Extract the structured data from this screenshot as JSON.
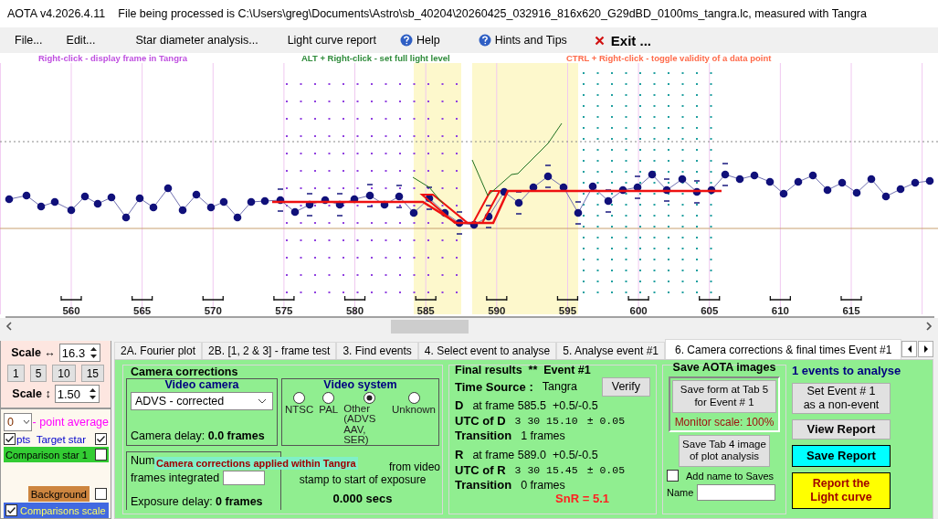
{
  "window": {
    "app_version": "AOTA v4.2026.4.11",
    "title": "File being processed is C:\\Users\\greg\\Documents\\Astro\\sb_40204\\20260425_032916_816x620_G29dBD_0100ms_tangra.lc, measured with Tangra"
  },
  "menu": [
    {
      "label": "File...",
      "kind": "plain"
    },
    {
      "label": "Edit...",
      "kind": "plain"
    },
    {
      "label": "Star diameter analysis...",
      "kind": "plain"
    },
    {
      "label": "Light curve report",
      "kind": "plain"
    },
    {
      "label": "Help",
      "kind": "help"
    },
    {
      "label": "Hints and Tips",
      "kind": "help"
    },
    {
      "label": "Exit ...",
      "kind": "exit"
    }
  ],
  "hints": [
    {
      "text": "Right-click - display frame in Tangra",
      "color": "#bf4fe0"
    },
    {
      "text": "ALT + Right-click - set full light level",
      "color": "#2e8b3a"
    },
    {
      "text": "CTRL + Right-click - toggle validity of a data point",
      "color": "#ff6a4a"
    }
  ],
  "chart": {
    "x_labels": [
      "560",
      "565",
      "570",
      "575",
      "580",
      "585",
      "590",
      "595",
      "600",
      "605",
      "610",
      "615"
    ]
  },
  "scale": {
    "horizontal_label": "Scale ↔",
    "horizontal_value": "16.3",
    "buttons": [
      "1",
      "5",
      "10",
      "15"
    ],
    "vertical_label": "Scale ↕",
    "vertical_value": "1.50"
  },
  "plot_options": {
    "average_value": "0",
    "average_label": "- point average",
    "items": [
      {
        "kind": "points",
        "label": "pts",
        "checked": true
      },
      {
        "kind": "target",
        "label": "Target star",
        "checked": true
      },
      {
        "kind": "band",
        "label": "Comparison star 1",
        "checked": false,
        "color": "#33cc33"
      },
      {
        "kind": "background",
        "label": "Background",
        "checked": false,
        "color": "#cd853f"
      },
      {
        "kind": "band",
        "label": "Comparisons scale",
        "checked": true,
        "color": "#4169e1"
      }
    ]
  },
  "tabs": [
    {
      "label": "2A. Fourier plot",
      "selected": false
    },
    {
      "label": "2B. [1, 2 & 3] - frame test",
      "selected": false
    },
    {
      "label": "3. Find events",
      "selected": false
    },
    {
      "label": "4. Select event to analyse",
      "selected": false
    },
    {
      "label": "5. Analyse event #1",
      "selected": false
    },
    {
      "label": "6. Camera corrections & final times Event #1",
      "selected": true
    }
  ],
  "camera_corrections": {
    "title": "Camera corrections",
    "video_camera": {
      "title": "Video camera",
      "value": "ADVS - corrected",
      "delay": "Camera delay: **0.0 frames**"
    },
    "video_system": {
      "title": "Video system",
      "options": [
        {
          "label": "NTSC",
          "selected": false
        },
        {
          "label": "PAL",
          "selected": false
        },
        {
          "label": "Other (ADVS AAV, SER)",
          "selected": true
        },
        {
          "label": "Unknown",
          "selected": false
        }
      ]
    },
    "frames_label_start": "Num",
    "frames_label_end": "frames integrated",
    "exposure_delay": "Exposure delay: **0 frames**",
    "note_lines": [
      "from video",
      "stamp to start of exposure"
    ],
    "offset": "0.000 secs",
    "overlay": "Camera corrections applied within Tangra"
  },
  "final_results": {
    "title": "Final results  **  Event #1",
    "time_source_label": "Time Source :",
    "time_source": "Tangra",
    "verify": "Verify",
    "events": [
      {
        "letter": "D",
        "frame": "at frame 585.5  +0.5/-0.5",
        "utc_label": "UTC of D",
        "utc": "3 30 15.10",
        "error": "± 0.05",
        "transition_label": "Transition",
        "transition": "1 frames"
      },
      {
        "letter": "R",
        "frame": "at frame 589.0  +0.5/-0.5",
        "utc_label": "UTC of R",
        "utc": "3 30 15.45",
        "error": "± 0.05",
        "transition_label": "Transition",
        "transition": "0 frames"
      }
    ],
    "snr": "SnR = 5.1"
  },
  "save_images": {
    "title": "Save AOTA images",
    "save_form": "Save form at Tab 5 for Event # 1",
    "monitor_scale": "Monitor scale: 100%",
    "save_tab4": "Save Tab 4 image of plot analysis",
    "add_name": {
      "label": "Add name to Saves",
      "checked": false
    },
    "name_label": "Name"
  },
  "events_panel": {
    "count_text": "1 events to analyse",
    "buttons": [
      {
        "label": "Set Event # 1 as a non-event",
        "kind": "plain"
      },
      {
        "label": "View Report",
        "kind": "bold"
      },
      {
        "label": "Save Report",
        "kind": "save"
      },
      {
        "label": "Report the Light curve",
        "kind": "report"
      }
    ]
  }
}
